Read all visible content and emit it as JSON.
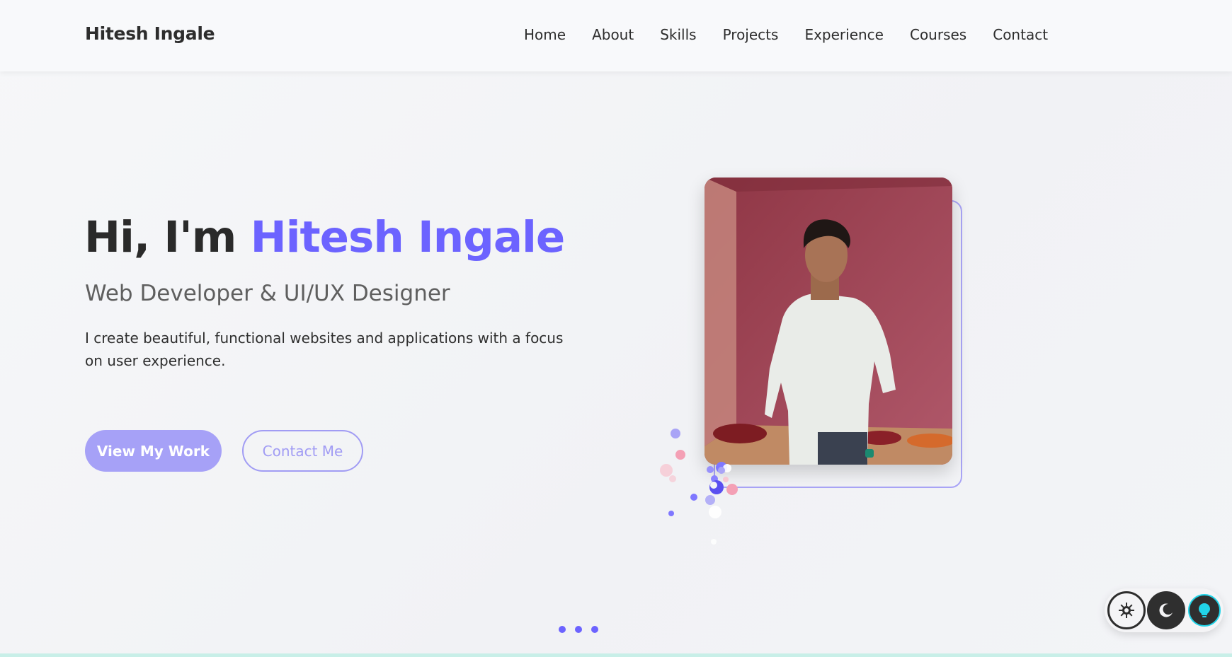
{
  "navbar": {
    "brand": "Hitesh Ingale",
    "links": [
      "Home",
      "About",
      "Skills",
      "Projects",
      "Experience",
      "Courses",
      "Contact"
    ]
  },
  "hero": {
    "greeting": "Hi, I'm",
    "name": "Hitesh Ingale",
    "subtitle": "Web Developer & UI/UX Designer",
    "description": "I create beautiful, functional websites and applications with a focus on user experience.",
    "primary_button": "View My Work",
    "secondary_button": "Contact Me"
  },
  "theme_controls": {
    "icons": [
      "sun-gear-icon",
      "moon-icon",
      "lightbulb-icon"
    ]
  },
  "colors": {
    "accent": "#6c63ff",
    "button_primary": "#a6a1f7",
    "photo_background": "#9e4350",
    "idea_accent": "#21d4e8"
  }
}
